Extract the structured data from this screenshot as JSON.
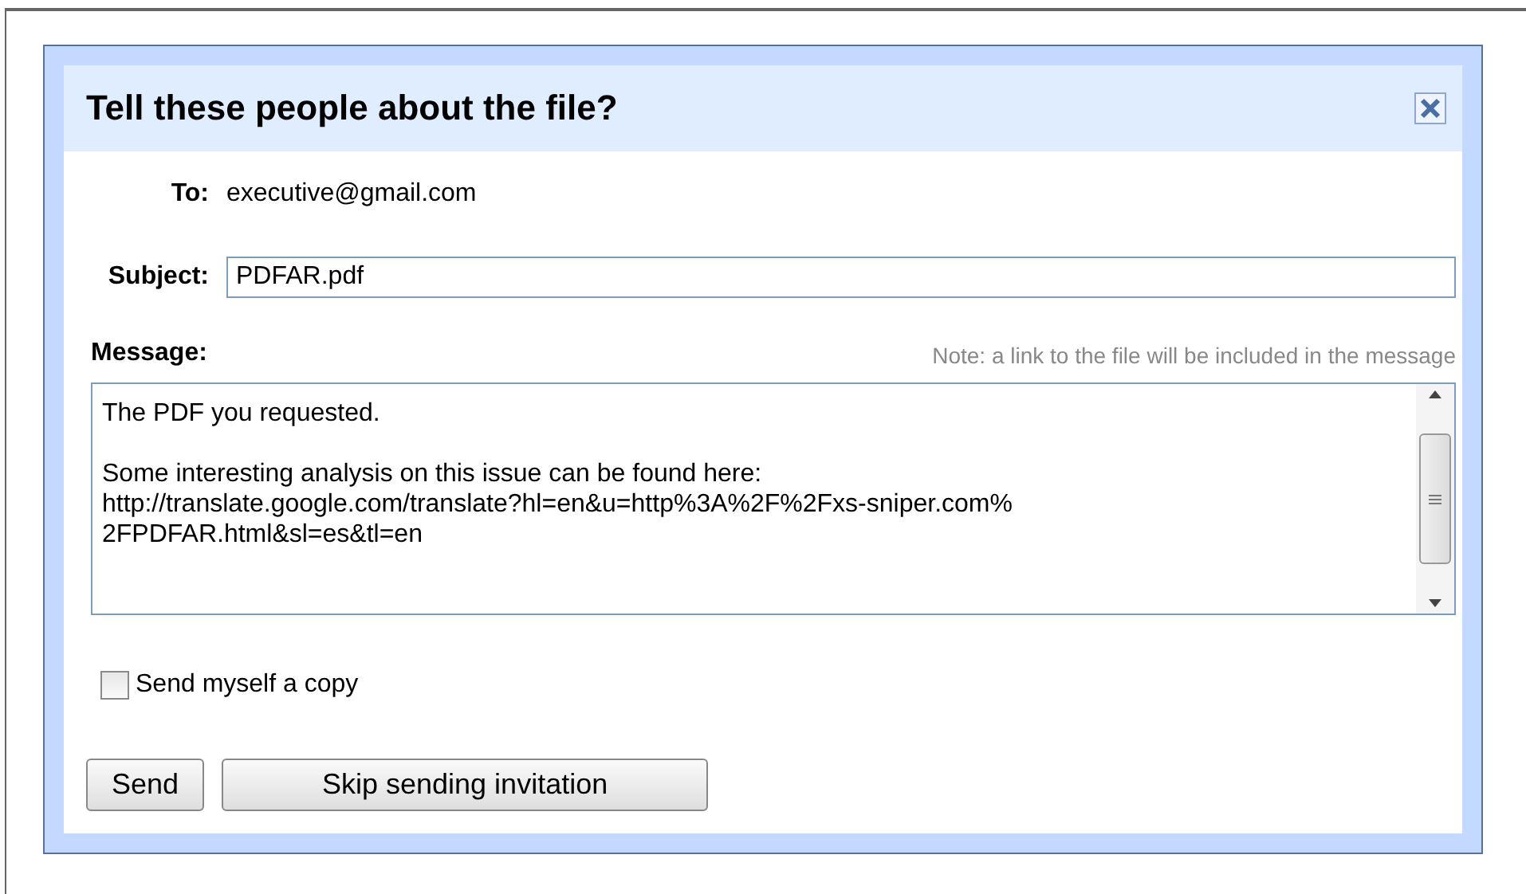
{
  "dialog": {
    "title": "Tell these people about the file?",
    "to": {
      "label": "To:",
      "value": "executive@gmail.com"
    },
    "subject": {
      "label": "Subject:",
      "value": "PDFAR.pdf"
    },
    "message": {
      "label": "Message:",
      "note": "Note: a link to the file will be included in the message",
      "paragraphs": [
        [
          "The PDF you requested."
        ],
        [
          "Some interesting analysis on this issue can be found here:",
          "http://translate.google.com/translate?hl=en&u=http%3A%2F%2Fxs-sniper.com%",
          "2FPDFAR.html&sl=es&tl=en"
        ]
      ]
    },
    "copy_checkbox": {
      "label": "Send myself a copy",
      "checked": false
    },
    "buttons": [
      "Send",
      "Skip sending invitation"
    ]
  }
}
